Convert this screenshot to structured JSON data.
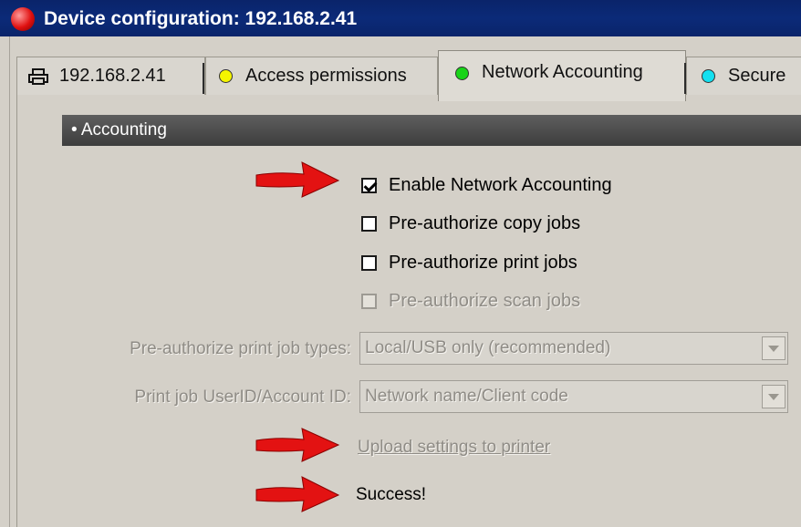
{
  "window": {
    "title": "Device configuration: 192.168.2.41"
  },
  "tabs": [
    {
      "label": "192.168.2.41",
      "icon": "printer-icon"
    },
    {
      "label": "Access permissions",
      "icon": "yellow-dot",
      "dot_color": "#f5f500"
    },
    {
      "label": "Network Accounting",
      "icon": "green-dot",
      "dot_color": "#19d419",
      "selected": true
    },
    {
      "label": "Secure",
      "icon": "cyan-dot",
      "dot_color": "#14e0f0"
    }
  ],
  "section": {
    "header": "• Accounting"
  },
  "options": {
    "enable_network_accounting": {
      "label": "Enable Network Accounting",
      "checked": true,
      "enabled": true
    },
    "preauth_copy": {
      "label": "Pre-authorize copy jobs",
      "checked": false,
      "enabled": true
    },
    "preauth_print": {
      "label": "Pre-authorize print jobs",
      "checked": false,
      "enabled": true
    },
    "preauth_scan": {
      "label": "Pre-authorize scan jobs",
      "checked": false,
      "enabled": false
    }
  },
  "fields": {
    "print_job_types": {
      "label": "Pre-authorize print job types:",
      "value": "Local/USB only (recommended)",
      "enabled": false
    },
    "user_account_id": {
      "label": "Print job UserID/Account ID:",
      "value": "Network name/Client code",
      "enabled": false
    }
  },
  "actions": {
    "upload_label": "Upload settings to printer"
  },
  "status": {
    "text": "Success!"
  },
  "colors": {
    "titlebar": "#0a246a",
    "annotation_arrow": "#e31212"
  }
}
